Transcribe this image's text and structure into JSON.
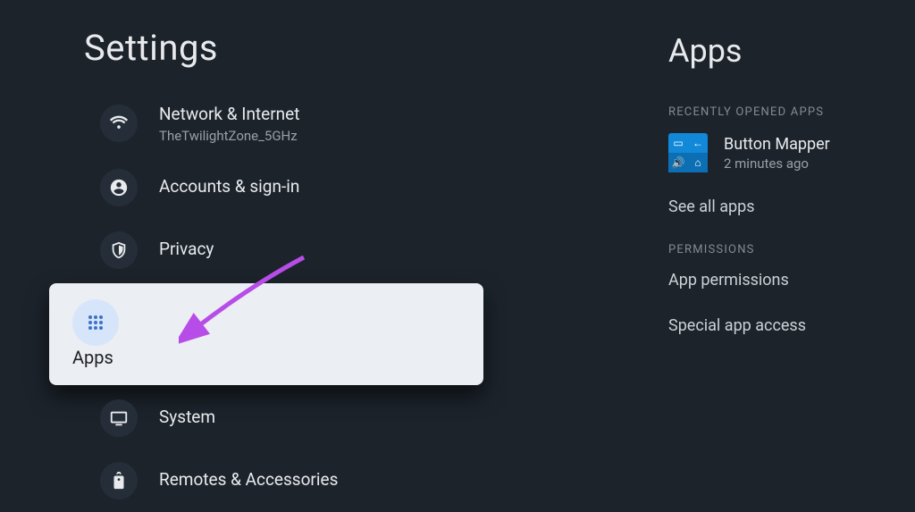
{
  "left": {
    "title": "Settings",
    "items": [
      {
        "label": "Network & Internet",
        "sublabel": "TheTwilightZone_5GHz",
        "icon": "wifi"
      },
      {
        "label": "Accounts & sign-in",
        "icon": "account"
      },
      {
        "label": "Privacy",
        "icon": "shield"
      },
      {
        "label": "Apps",
        "icon": "apps",
        "selected": true
      },
      {
        "label": "System",
        "icon": "monitor"
      },
      {
        "label": "Remotes & Accessories",
        "icon": "remote"
      }
    ]
  },
  "right": {
    "title": "Apps",
    "sections": {
      "recent_header": "RECENTLY OPENED APPS",
      "recent_app": {
        "name": "Button Mapper",
        "time": "2 minutes ago"
      },
      "see_all": "See all apps",
      "permissions_header": "PERMISSIONS",
      "app_permissions": "App permissions",
      "special_access": "Special app access"
    }
  }
}
